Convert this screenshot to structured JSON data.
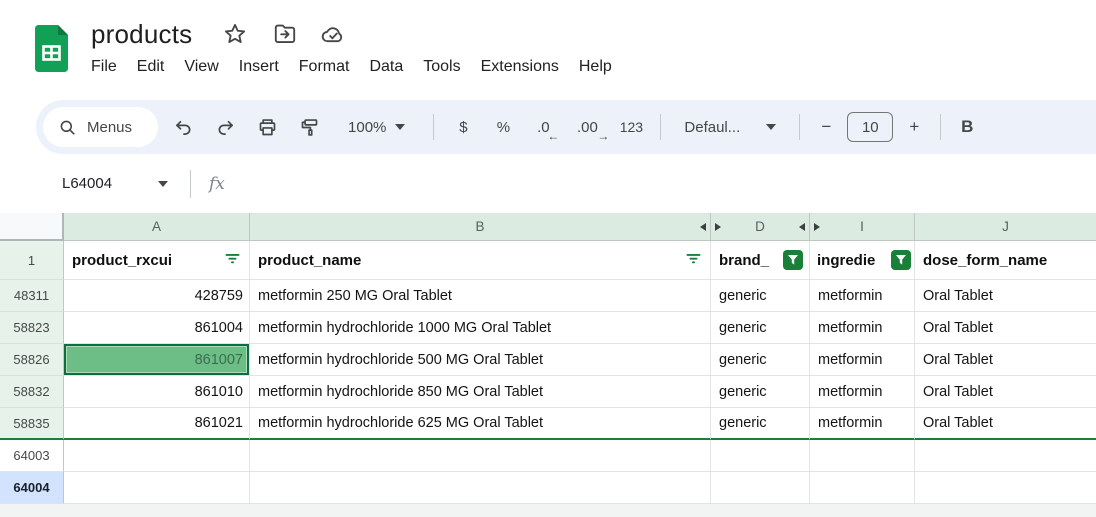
{
  "titlebar": {
    "title": "products",
    "star_icon": "star-outline",
    "move_icon": "move-to-folder",
    "sync_icon": "cloud-saved-check"
  },
  "menubar": {
    "items": [
      "File",
      "Edit",
      "View",
      "Insert",
      "Format",
      "Data",
      "Tools",
      "Extensions",
      "Help"
    ]
  },
  "toolbar": {
    "menus_label": "Menus",
    "zoom_value": "100%",
    "currency_label": "$",
    "percent_label": "%",
    "decrease_decimal_label": ".0",
    "increase_decimal_label": ".00",
    "number_format_label": "123",
    "style_value": "Defaul...",
    "decrease_font_label": "−",
    "font_size_value": "10",
    "increase_font_label": "+",
    "bold_label": "B"
  },
  "formula_bar": {
    "name_box_value": "L64004",
    "fx_label": "fx"
  },
  "sheet": {
    "column_letters": {
      "a": "A",
      "b": "B",
      "d": "D",
      "i": "I",
      "j": "J"
    },
    "header_row": {
      "label": "1",
      "rxcui": "product_rxcui",
      "name": "product_name",
      "brand": "brand_",
      "ingredient": "ingredie",
      "dose_form": "dose_form_name"
    },
    "rows": [
      {
        "label": "48311",
        "rxcui": "428759",
        "name": "metformin 250 MG Oral Tablet",
        "brand": "generic",
        "ingredient": "metformin",
        "dose_form": "Oral Tablet"
      },
      {
        "label": "58823",
        "rxcui": "861004",
        "name": "metformin hydrochloride 1000 MG Oral Tablet",
        "brand": "generic",
        "ingredient": "metformin",
        "dose_form": "Oral Tablet"
      },
      {
        "label": "58826",
        "rxcui": "861007",
        "name": "metformin hydrochloride 500 MG Oral Tablet",
        "brand": "generic",
        "ingredient": "metformin",
        "dose_form": "Oral Tablet"
      },
      {
        "label": "58832",
        "rxcui": "861010",
        "name": "metformin hydrochloride 850 MG Oral Tablet",
        "brand": "generic",
        "ingredient": "metformin",
        "dose_form": "Oral Tablet"
      },
      {
        "label": "58835",
        "rxcui": "861021",
        "name": "metformin hydrochloride 625 MG Oral Tablet",
        "brand": "generic",
        "ingredient": "metformin",
        "dose_form": "Oral Tablet"
      }
    ],
    "empty_rows": [
      {
        "label": "64003"
      },
      {
        "label": "64004"
      }
    ],
    "selection": {
      "active_cell": "L64004",
      "highlighted_cell": "A58826",
      "highlighted_value": "861007"
    },
    "colors": {
      "accent_green": "#188038",
      "highlight_fill": "#6dbe86",
      "highlight_border": "#0b6e3d",
      "filtered_row_header_bg": "#e7f2ea",
      "column_header_bg": "#dcebe1",
      "active_row_header_bg": "#d3e3fd",
      "toolbar_bg": "#edf2fa",
      "logo_green": "#12a056"
    }
  }
}
